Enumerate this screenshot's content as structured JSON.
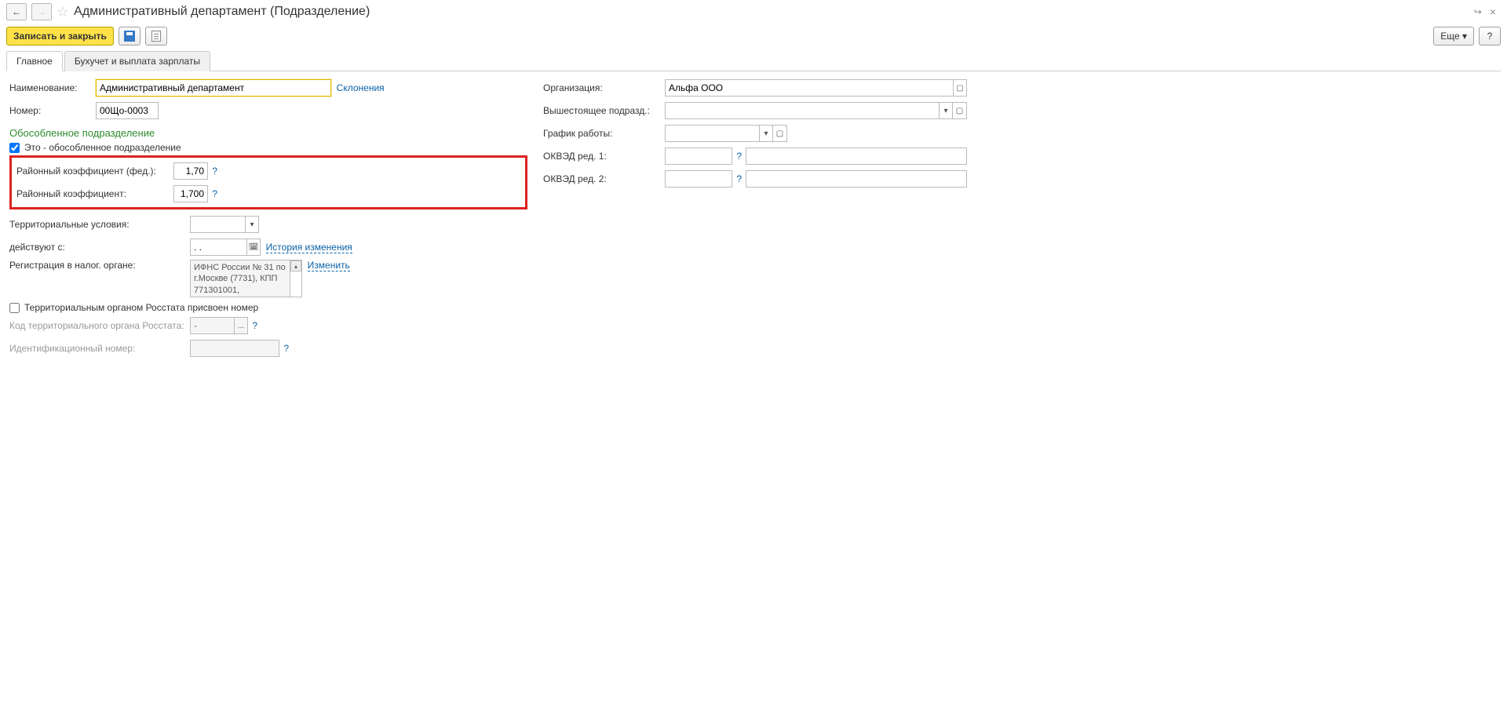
{
  "header": {
    "title": "Административный департамент (Подразделение)",
    "nav_back": "←",
    "nav_fwd": "→",
    "star": "☆",
    "ext_link": "🔗",
    "close": "×"
  },
  "toolbar": {
    "save_close": "Записать и закрыть",
    "more": "Еще",
    "more_caret": "▾",
    "help": "?"
  },
  "tabs": {
    "main": "Главное",
    "accounting": "Бухучет и выплата зарплаты"
  },
  "left": {
    "name_label": "Наименование:",
    "name_value": "Административный департамент",
    "declension_link": "Склонения",
    "number_label": "Номер:",
    "number_value": "00Що-0003",
    "section_separate": "Обособленное подразделение",
    "separate_checkbox_label": "Это - обособленное подразделение",
    "coef_fed_label": "Районный коэффициент (фед.):",
    "coef_fed_value": "1,70",
    "coef_label": "Районный коэффициент:",
    "coef_value": "1,700",
    "territory_label": "Территориальные условия:",
    "effective_from_label": "действуют с:",
    "effective_from_value": ". .",
    "history_link": "История изменения",
    "tax_reg_label": "Регистрация в налог. органе:",
    "tax_reg_value": "ИФНС России № 31 по г.Москве (7731), КПП 771301001,",
    "change_link": "Изменить",
    "rosstat_assigned_label": "Территориальным органом Росстата присвоен номер",
    "rosstat_code_label": "Код территориального органа Росстата:",
    "rosstat_code_placeholder": "-",
    "id_number_label": "Идентификационный номер:"
  },
  "right": {
    "org_label": "Организация:",
    "org_value": "Альфа ООО",
    "parent_label": "Вышестоящее подразд.:",
    "schedule_label": "График работы:",
    "okved1_label": "ОКВЭД ред. 1:",
    "okved2_label": "ОКВЭД ред. 2:"
  },
  "glyphs": {
    "dropdown": "▾",
    "open": "▫",
    "calendar": "📅",
    "dots": "...",
    "help": "?",
    "scrollup": "▴"
  }
}
